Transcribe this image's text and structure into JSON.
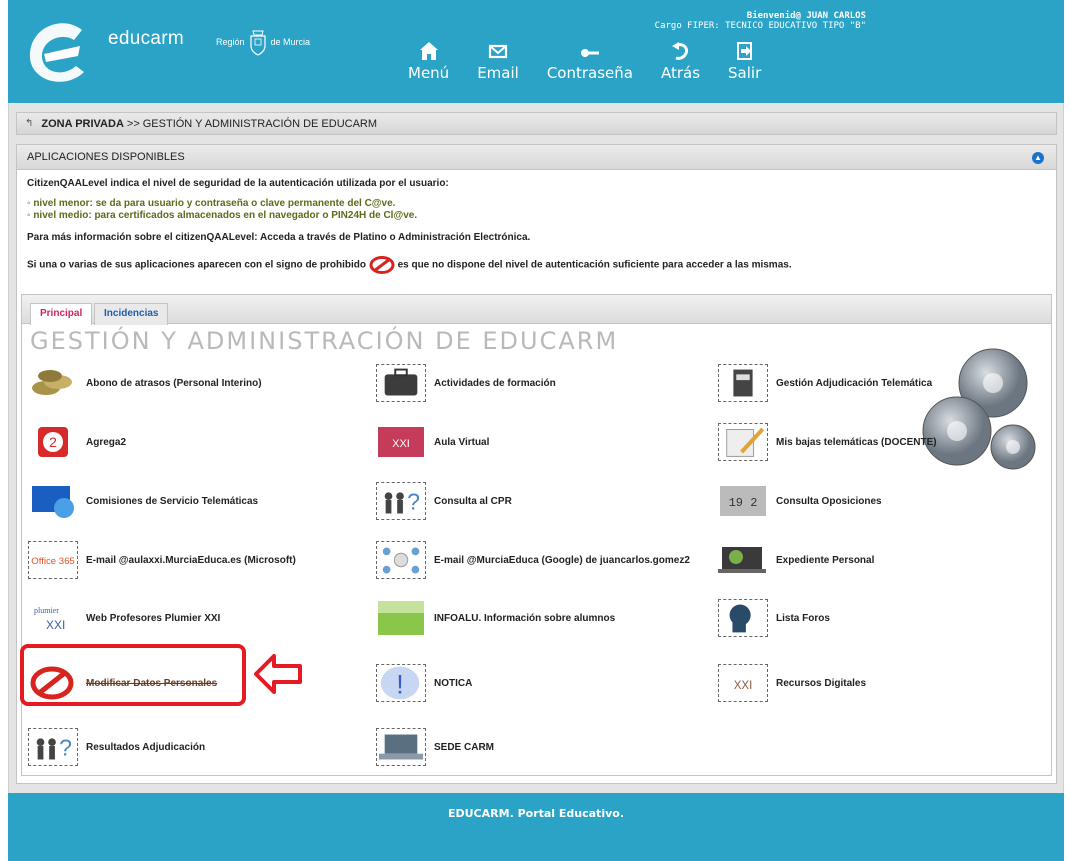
{
  "header": {
    "brand": "educarm",
    "region_left": "Región",
    "region_right": "de Murcia",
    "welcome_line1": "Bienvenid@ JUAN CARLOS",
    "welcome_line2": "Cargo FIPER: TECNICO EDUCATIVO TIPO \"B\"",
    "nav": [
      {
        "label": "Menú",
        "icon": "home-icon"
      },
      {
        "label": "Email",
        "icon": "mail-icon"
      },
      {
        "label": "Contraseña",
        "icon": "key-icon"
      },
      {
        "label": "Atrás",
        "icon": "back-arrow-icon"
      },
      {
        "label": "Salir",
        "icon": "logout-icon"
      }
    ]
  },
  "breadcrumb": {
    "strong": "ZONA PRIVADA",
    "separator": ">>",
    "rest": "GESTIÓN Y ADMINISTRACIÓN DE EDUCARM"
  },
  "panel": {
    "title": "APLICACIONES DISPONIBLES",
    "info_line1": "CitizenQAALevel indica el nivel de seguridad de la autenticación utilizada por el usuario:",
    "bullet1": "nivel menor: se da para usuario y contraseña o clave permanente del C@ve.",
    "bullet2": "nivel medio: para certificados almacenados en el navegador o PIN24H de Cl@ve.",
    "info_line2": "Para más información sobre el citizenQAALevel: Acceda a través de Platino o Administración Electrónica.",
    "info_line3a": "Si una o varias de sus aplicaciones aparecen con el signo de prohibido",
    "info_line3b": "es que no dispone del nivel de autenticación suficiente para acceder a las mismas."
  },
  "tabs": [
    {
      "label": "Principal",
      "active": true
    },
    {
      "label": "Incidencias",
      "active": false
    }
  ],
  "section_title": "GESTIÓN Y ADMINISTRACIÓN DE EDUCARM",
  "apps": [
    {
      "label": "Abono de atrasos (Personal Interino)",
      "icon": "coins-icon"
    },
    {
      "label": "Actividades de formación",
      "icon": "briefcase-icon"
    },
    {
      "label": "Gestión Adjudicación Telemática",
      "icon": "document-icon"
    },
    {
      "label": "Agrega2",
      "icon": "agrega2-icon"
    },
    {
      "label": "Aula Virtual",
      "icon": "aula-virtual-icon"
    },
    {
      "label": "Mis bajas telemáticas (DOCENTE)",
      "icon": "pencil-notes-icon"
    },
    {
      "label": "Comisiones de Servicio Telemáticas",
      "icon": "monitor-icon"
    },
    {
      "label": "Consulta al CPR",
      "icon": "people-question-icon"
    },
    {
      "label": "Consulta Oposiciones",
      "icon": "numbers-icon"
    },
    {
      "label": "E-mail @aulaxxi.MurciaEduca.es (Microsoft)",
      "icon": "office365-icon",
      "icon_text": "Office 365"
    },
    {
      "label": "E-mail @MurciaEduca (Google) de juancarlos.gomez2",
      "icon": "google-network-icon"
    },
    {
      "label": "Expediente Personal",
      "icon": "laptop-person-icon"
    },
    {
      "label": "Web Profesores Plumier XXI",
      "icon": "plumier-icon"
    },
    {
      "label": "INFOALU. Información sobre alumnos",
      "icon": "grass-icon"
    },
    {
      "label": "Lista Foros",
      "icon": "head-profile-icon"
    },
    {
      "label": "Modificar Datos Personales",
      "icon": "prohibited-icon",
      "blocked": true
    },
    {
      "label": "NOTICA",
      "icon": "exclamation-icon"
    },
    {
      "label": "Recursos Digitales",
      "icon": "aula-xxi-icon"
    },
    {
      "label": "Resultados Adjudicación",
      "icon": "people-question-icon"
    },
    {
      "label": "SEDE CARM",
      "icon": "sede-laptop-icon"
    }
  ],
  "footer": "EDUCARM. Portal Educativo.",
  "colors": {
    "header": "#2aa3c7",
    "tab_active": "#d0245a",
    "tab_other": "#1e5ea8",
    "highlight": "#e51b23"
  }
}
